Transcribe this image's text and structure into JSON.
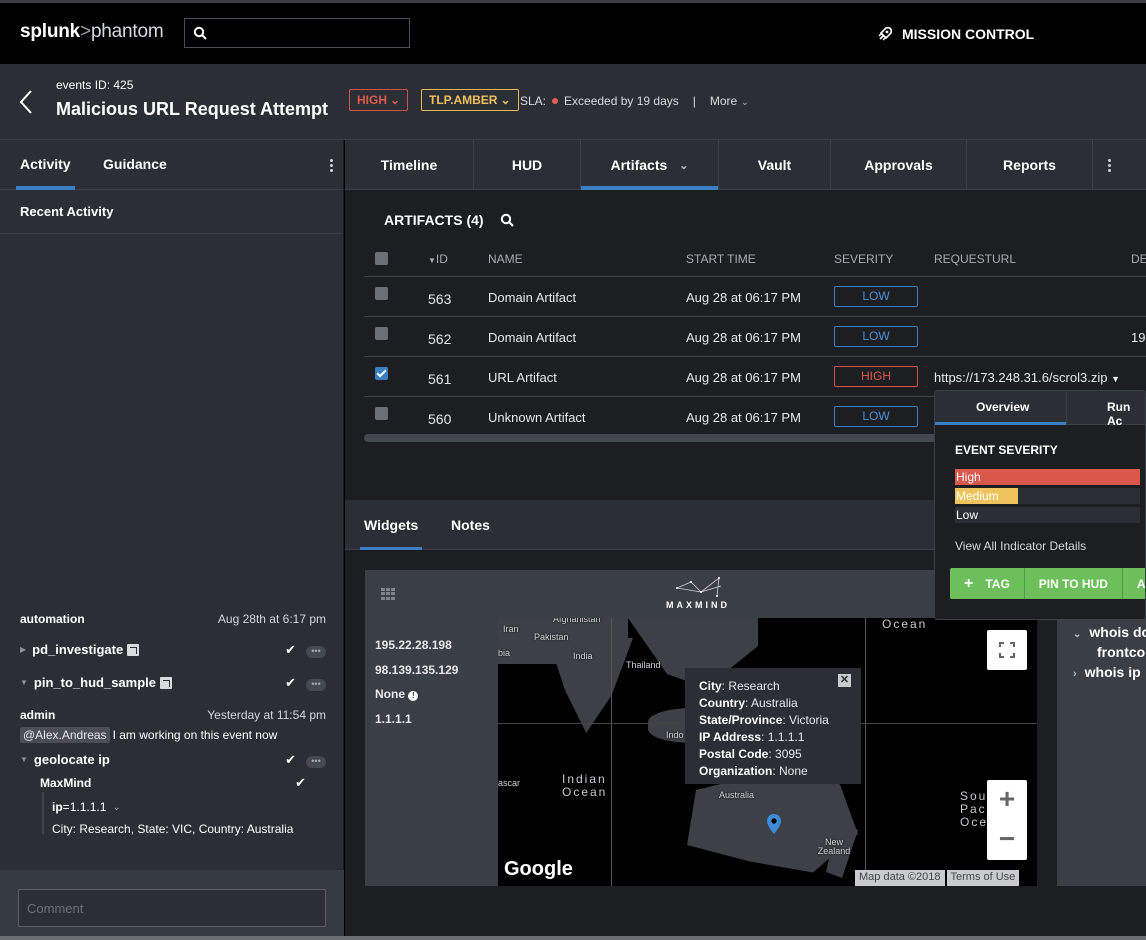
{
  "topbar": {
    "logo_brand": "splunk",
    "logo_sep": ">",
    "logo_product": "phantom",
    "search_placeholder": "",
    "mission_control": "MISSION CONTROL"
  },
  "header": {
    "event_id": "events ID: 425",
    "title": "Malicious URL Request Attempt",
    "severity": "HIGH",
    "tlp": "TLP.AMBER",
    "sla_label": "SLA:",
    "sla_status": "Exceeded by 19 days",
    "separator": "|",
    "more": "More"
  },
  "colors": {
    "accent": "#3a7fc4",
    "high": "#e05a4e",
    "medium": "#f0c15c",
    "success": "#6cbf5a",
    "background": "#2b2e35"
  },
  "left_panel": {
    "tabs": [
      {
        "label": "Activity",
        "active": true
      },
      {
        "label": "Guidance",
        "active": false
      }
    ],
    "recent_title": "Recent Activity",
    "activity": [
      {
        "user": "automation",
        "time": "Aug 28th at 6:17 pm",
        "items": [
          {
            "name": "pd_investigate",
            "expanded": false,
            "status": "success"
          },
          {
            "name": "pin_to_hud_sample",
            "expanded": true,
            "status": "success"
          }
        ]
      },
      {
        "user": "admin",
        "time": "Yesterday at 11:54 pm",
        "mention": "@Alex.Andreas",
        "message": "I am working on this event now",
        "action": {
          "name": "geolocate ip",
          "expanded": true,
          "status": "success",
          "app": "MaxMind",
          "param_key": "ip",
          "param_eq": " = ",
          "param_value": "1.1.1.1",
          "result": "City: Research, State: VIC, Country: Australia"
        }
      }
    ],
    "comment_placeholder": "Comment"
  },
  "main_tabs": [
    {
      "label": "Timeline",
      "active": false
    },
    {
      "label": "HUD",
      "active": false
    },
    {
      "label": "Artifacts",
      "active": true,
      "dropdown": true
    },
    {
      "label": "Vault",
      "active": false
    },
    {
      "label": "Approvals",
      "active": false
    },
    {
      "label": "Reports",
      "active": false
    }
  ],
  "artifacts": {
    "title": "ARTIFACTS (4)",
    "columns": [
      "ID",
      "NAME",
      "START TIME",
      "SEVERITY",
      "REQUESTURL",
      "DE"
    ],
    "rows": [
      {
        "id": "563",
        "name": "Domain Artifact",
        "start_time": "Aug 28 at 06:17 PM",
        "severity": "LOW",
        "requesturl": "",
        "extra": "",
        "checked": false
      },
      {
        "id": "562",
        "name": "Domain Artifact",
        "start_time": "Aug 28 at 06:17 PM",
        "severity": "LOW",
        "requesturl": "",
        "extra": "19",
        "checked": false
      },
      {
        "id": "561",
        "name": "URL Artifact",
        "start_time": "Aug 28 at 06:17 PM",
        "severity": "HIGH",
        "requesturl": "https://173.248.31.6/scrol3.zip",
        "extra": "",
        "checked": true
      },
      {
        "id": "560",
        "name": "Unknown Artifact",
        "start_time": "Aug 28 at 06:17 PM",
        "severity": "LOW",
        "requesturl": "",
        "extra": "",
        "checked": false
      }
    ]
  },
  "popover": {
    "tabs": [
      "Overview",
      "Run Ac"
    ],
    "severity_title": "EVENT SEVERITY",
    "bars": [
      {
        "label": "High",
        "fraction": 1.0,
        "color": "#d9574b"
      },
      {
        "label": "Medium",
        "fraction": 0.34,
        "color": "#efc45f"
      },
      {
        "label": "Low",
        "fraction": 0.0,
        "color": "#3a7fc4"
      }
    ],
    "view_all": "View All Indicator Details",
    "actions": [
      "TAG",
      "PIN TO HUD",
      "AD"
    ]
  },
  "widgets": {
    "tabs": [
      {
        "label": "Widgets",
        "active": true
      },
      {
        "label": "Notes",
        "active": false
      }
    ],
    "maxmind_label": "MAXMIND",
    "ips": [
      "195.22.28.198",
      "98.139.135.129",
      "None",
      "1.1.1.1"
    ],
    "map": {
      "labels": {
        "afghanistan": "Afghanistan",
        "iran": "Iran",
        "pakistan": "Pakistan",
        "arabia": "bia",
        "india": "India",
        "thailand": "Thailand",
        "indonesia": "Indo",
        "madagascar": "ascar",
        "australia": "Australia",
        "new_zealand": "New Zealand",
        "indian_ocean": "Indian Ocean",
        "ocean_top": "Ocean",
        "south_pacific": "Sou Pac Oce"
      },
      "info": [
        {
          "key": "City",
          "value": "Research"
        },
        {
          "key": "Country",
          "value": "Australia"
        },
        {
          "key": "State/Province",
          "value": "Victoria"
        },
        {
          "key": "IP Address",
          "value": "1.1.1.1"
        },
        {
          "key": "Postal Code",
          "value": "3095"
        },
        {
          "key": "Organization",
          "value": "None"
        }
      ],
      "google": "Google",
      "map_data": "Map data ©2018",
      "terms": "Terms of Use",
      "zoom_in": "+",
      "zoom_out": "−"
    },
    "side": {
      "items": [
        {
          "label": "whois do",
          "expanded": true,
          "sub": "frontcol"
        },
        {
          "label": "whois ip",
          "expanded": false
        }
      ]
    }
  }
}
